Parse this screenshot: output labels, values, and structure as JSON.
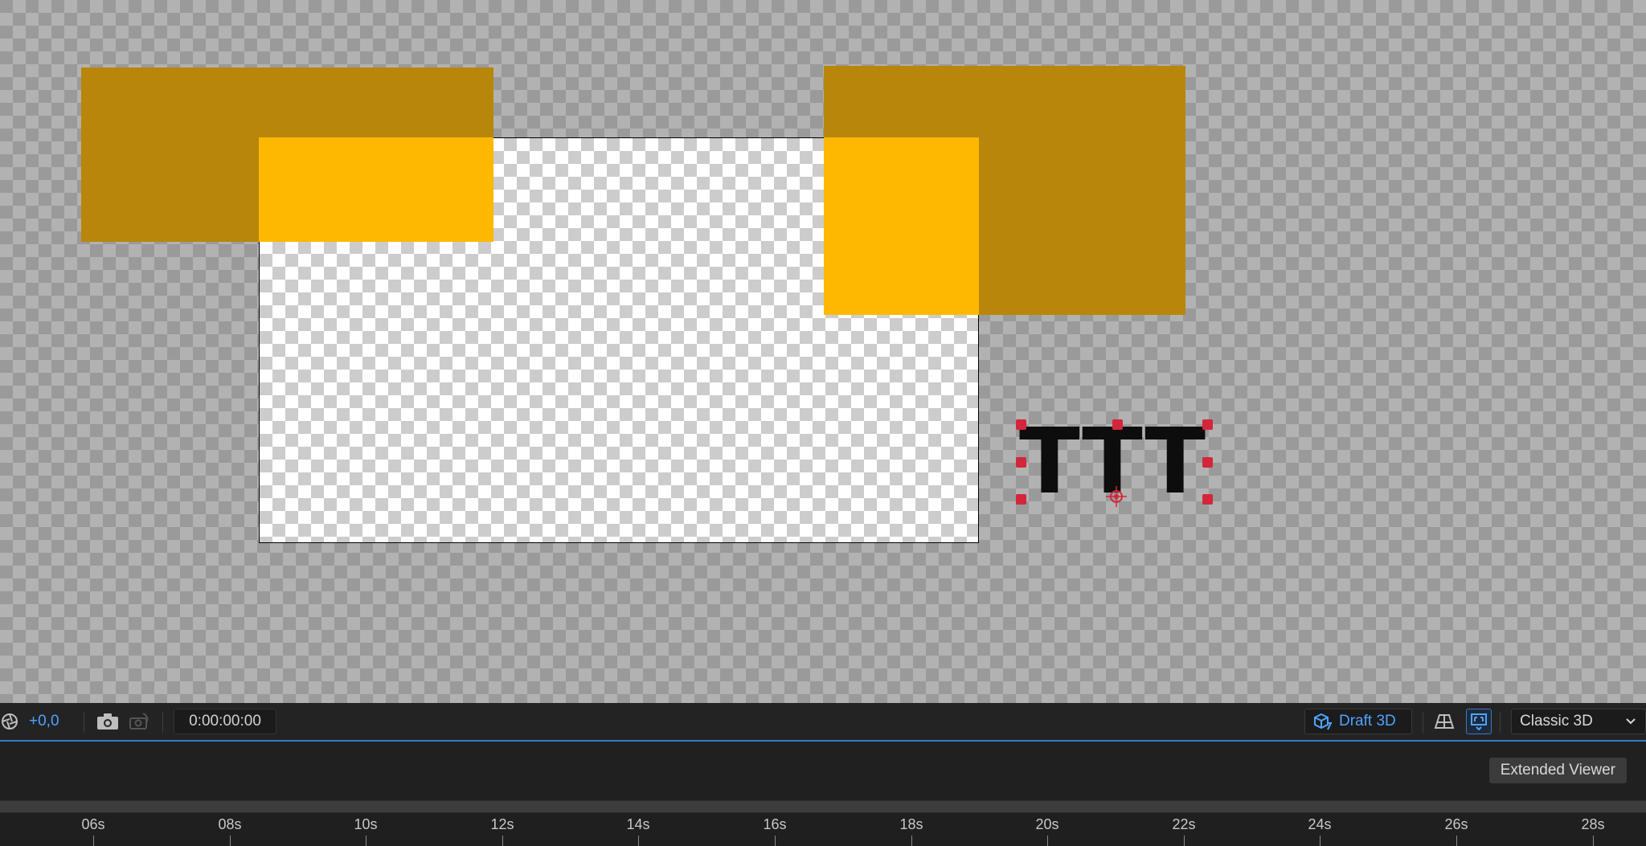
{
  "colors": {
    "shape_outside": "#b8860b",
    "shape_inside": "#ffb800",
    "handle": "#d3263a",
    "accent": "#4ea3ff"
  },
  "viewer": {
    "text_layer": {
      "content": "TTT"
    }
  },
  "toolbar": {
    "aperture_icon": "aperture-icon",
    "exposure_value": "+0,0",
    "snapshot_icon": "camera-icon",
    "show_snapshot_icon": "show-snapshot-icon",
    "timecode": "0:00:00:00",
    "draft_3d_label": "Draft 3D",
    "draft_3d_icon": "draft-3d-icon",
    "ground_plane_icon": "ground-plane-icon",
    "fast_preview_icon": "fast-preview-icon",
    "renderer_value": "Classic 3D"
  },
  "extended_viewer": {
    "button_label": "Extended Viewer"
  },
  "timeline": {
    "ticks": [
      "06s",
      "08s",
      "10s",
      "12s",
      "14s",
      "16s",
      "18s",
      "20s",
      "22s",
      "24s",
      "26s",
      "28s"
    ]
  }
}
